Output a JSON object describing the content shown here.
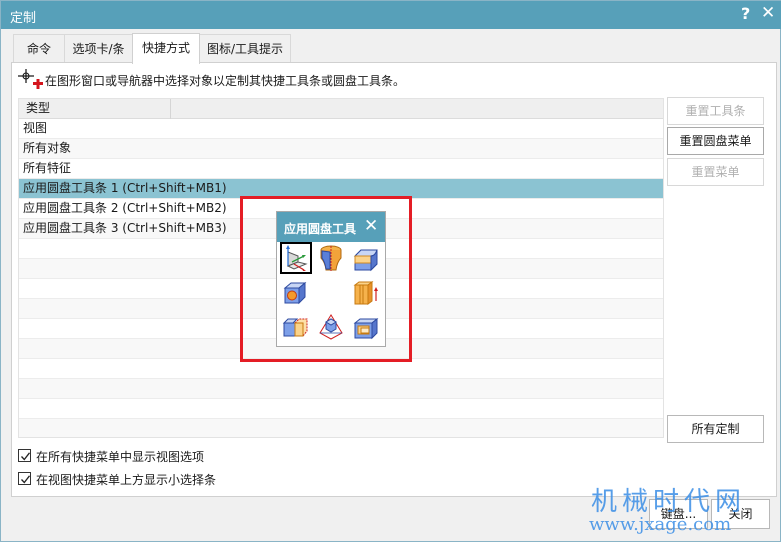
{
  "window": {
    "title": "定制",
    "help_label": "?",
    "close_label": "✕"
  },
  "tabs": [
    {
      "label": "命令",
      "active": false
    },
    {
      "label": "选项卡/条",
      "active": false
    },
    {
      "label": "快捷方式",
      "active": true
    },
    {
      "label": "图标/工具提示",
      "active": false
    }
  ],
  "hint": {
    "icon": "crosshair-add-icon",
    "text": "在图形窗口或导航器中选择对象以定制其快捷工具条或圆盘工具条。"
  },
  "list": {
    "header": "类型",
    "rows": [
      {
        "label": "视图",
        "selected": false
      },
      {
        "label": "所有对象",
        "selected": false
      },
      {
        "label": "所有特征",
        "selected": false
      },
      {
        "label": "应用圆盘工具条 1 (Ctrl+Shift+MB1)",
        "selected": true
      },
      {
        "label": "应用圆盘工具条 2 (Ctrl+Shift+MB2)",
        "selected": false
      },
      {
        "label": "应用圆盘工具条 3 (Ctrl+Shift+MB3)",
        "selected": false
      }
    ]
  },
  "side_buttons": {
    "reset_toolbar": {
      "label": "重置工具条",
      "enabled": false
    },
    "reset_radial": {
      "label": "重置圆盘菜单",
      "enabled": true
    },
    "reset_menu": {
      "label": "重置菜单",
      "enabled": false
    },
    "all_customizations": {
      "label": "所有定制",
      "enabled": true
    }
  },
  "checkboxes": [
    {
      "label": "在所有快捷菜单中显示视图选项",
      "checked": true
    },
    {
      "label": "在视图快捷菜单上方显示小选择条",
      "checked": true
    }
  ],
  "footer": {
    "keyboard_label": "键盘...",
    "close_label": "关闭"
  },
  "radial_toolbar": {
    "title": "应用圆盘工具",
    "close_label": "✕",
    "icons": [
      {
        "name": "datum-csys-icon",
        "selected": true
      },
      {
        "name": "split-body-icon",
        "selected": false
      },
      {
        "name": "edge-blend-icon",
        "selected": false
      },
      {
        "name": "hole-icon",
        "selected": false
      },
      {
        "name": "extrude-icon",
        "selected": false
      },
      {
        "name": "shell-icon",
        "selected": false
      },
      {
        "name": "draft-icon",
        "selected": false
      },
      {
        "name": "pocket-icon",
        "selected": false
      }
    ]
  },
  "watermark": {
    "line1": "机械时代网",
    "line2": "www.jxage.com"
  },
  "colors": {
    "titlebar": "#57a0b9",
    "selection": "#8bc3d2",
    "highlight_box": "#e41d25"
  }
}
